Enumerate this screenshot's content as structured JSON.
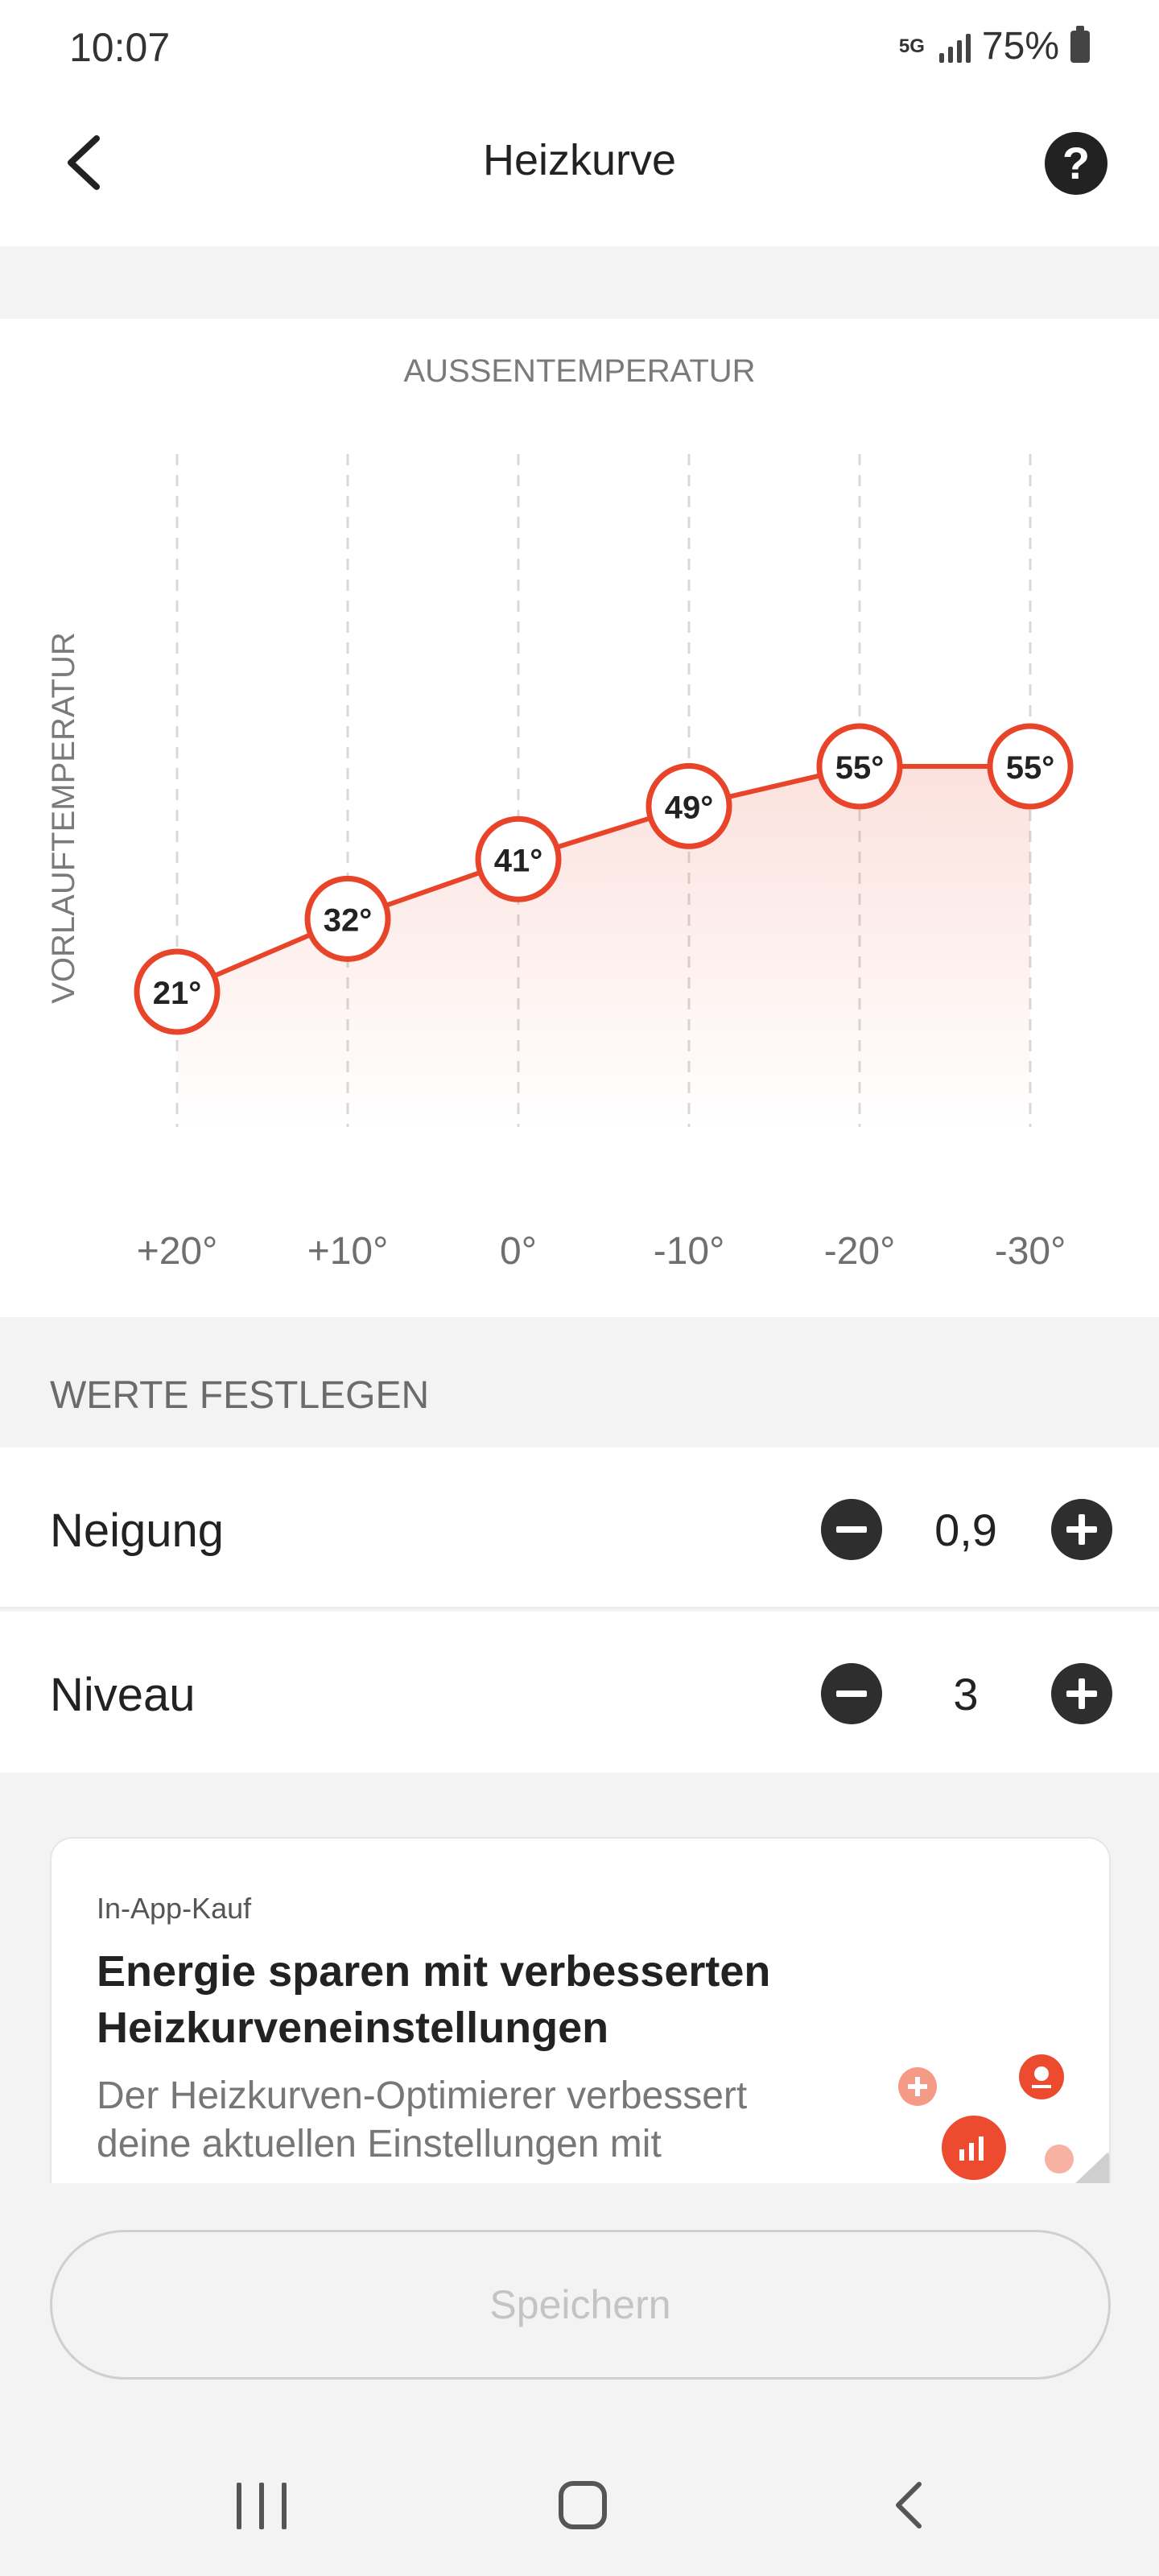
{
  "status_bar": {
    "time": "10:07",
    "network": "5G",
    "battery": "75%"
  },
  "header": {
    "title": "Heizkurve",
    "back_icon": "chevron-left-icon",
    "help_icon": "question-circle-icon"
  },
  "chart_data": {
    "type": "line",
    "title": "",
    "xlabel": "AUSSENTEMPERATUR",
    "ylabel": "VORLAUFTEMPERATUR",
    "categories": [
      "+20°",
      "+10°",
      "0°",
      "-10°",
      "-20°",
      "-30°"
    ],
    "series": [
      {
        "values": [
          21,
          32,
          41,
          49,
          55,
          55
        ]
      }
    ],
    "point_labels": [
      "21°",
      "32°",
      "41°",
      "49°",
      "55°",
      "55°"
    ],
    "grid": "vertical dashed",
    "line_color": "#e8442a",
    "fill": "gradient"
  },
  "settings": {
    "section_title": "WERTE FESTLEGEN",
    "neigung": {
      "label": "Neigung",
      "value": "0,9"
    },
    "niveau": {
      "label": "Niveau",
      "value": "3"
    }
  },
  "promo": {
    "tag": "In-App-Kauf",
    "title": "Energie sparen mit verbesserten Heizkurveneinstellungen",
    "text": "Der Heizkurven-Optimierer verbessert deine aktuellen Einstellungen mit"
  },
  "save_button": {
    "label": "Speichern"
  },
  "colors": {
    "accent": "#e8442a",
    "dark": "#2e2e2e",
    "background": "#f3f3f3"
  }
}
